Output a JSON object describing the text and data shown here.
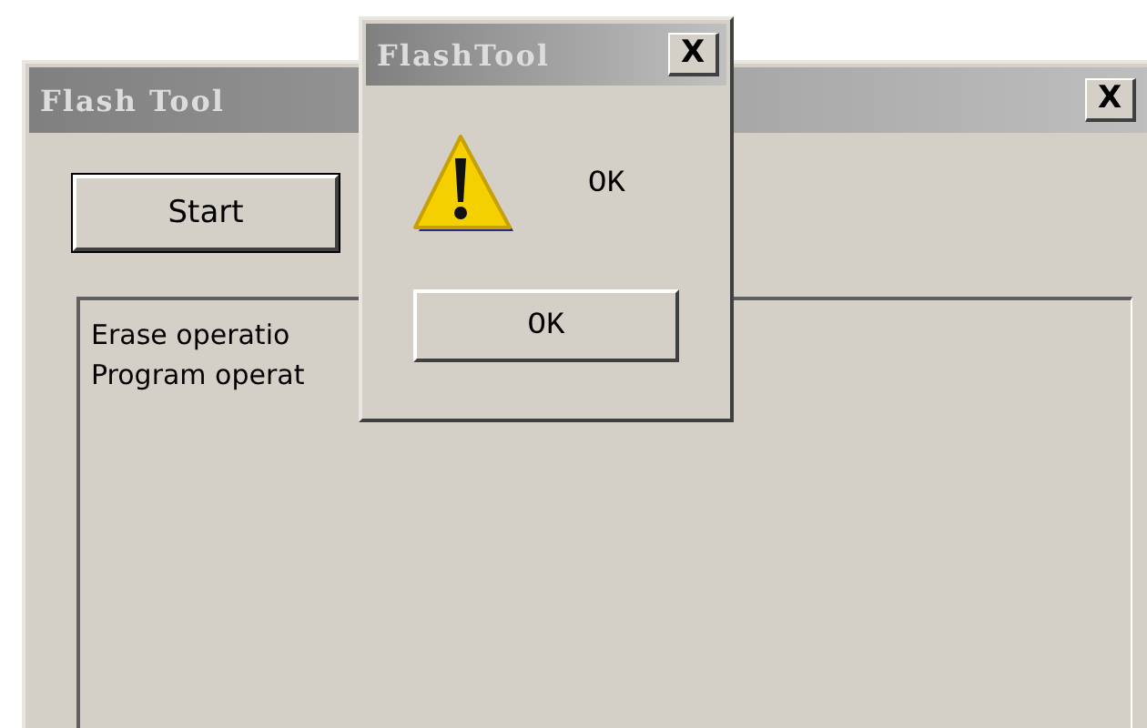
{
  "main_window": {
    "title": "Flash Tool",
    "close": "X",
    "start_button": "Start",
    "log": [
      "Erase operatio",
      "Program operat"
    ]
  },
  "dialog": {
    "title": "FlashTool",
    "close": "X",
    "message": "OK",
    "ok_button": "OK"
  }
}
